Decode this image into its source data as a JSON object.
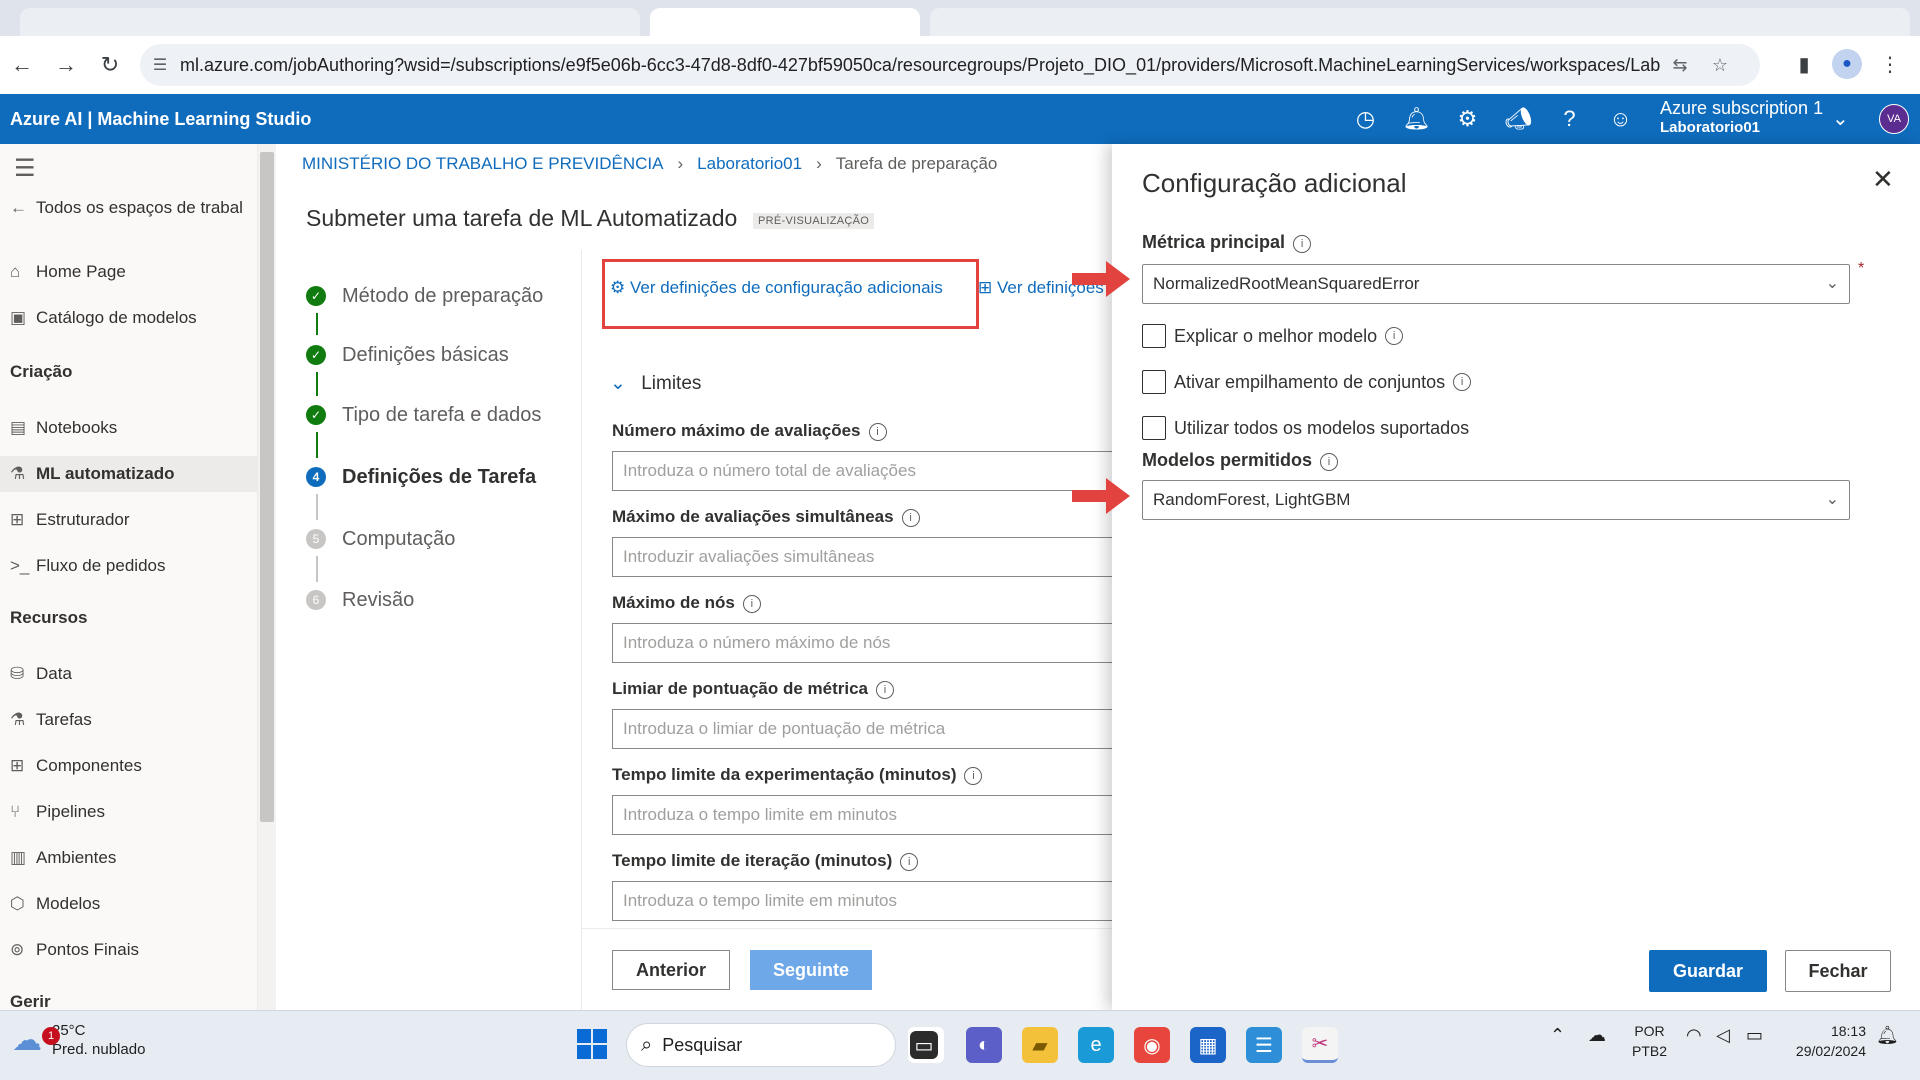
{
  "browser": {
    "url": "ml.azure.com/jobAuthoring?wsid=/subscriptions/e9f5e06b-6cc3-47d8-8df0-427bf59050ca/resourcegroups/Projeto_DIO_01/providers/Microsoft.MachineLearningServices/workspaces/Laborat...",
    "icons": {
      "back": "arrow-left",
      "forward": "arrow-right",
      "reload": "reload",
      "site_info": "tune",
      "translate": "translate",
      "bookmark": "star",
      "sidepanel": "sidepanel",
      "profile": "person",
      "menu": "kebab"
    }
  },
  "azure_header": {
    "brand": "Azure AI | Machine Learning Studio",
    "subscription": "Azure subscription 1",
    "workspace": "Laboratorio01",
    "avatar": "VA",
    "icons": [
      "history",
      "bell",
      "gear",
      "megaphone",
      "help",
      "smiley"
    ]
  },
  "sidebar": {
    "all_workspaces": "Todos os espaços de trabal",
    "items_top": [
      {
        "label": "Home Page",
        "icon": "home"
      },
      {
        "label": "Catálogo de modelos",
        "icon": "catalog"
      }
    ],
    "section_creation": "Criação",
    "items_creation": [
      {
        "label": "Notebooks",
        "icon": "notebook"
      },
      {
        "label": "ML automatizado",
        "icon": "automl",
        "active": true
      },
      {
        "label": "Estruturador",
        "icon": "designer"
      },
      {
        "label": "Fluxo de pedidos",
        "icon": "prompt-flow"
      }
    ],
    "section_resources": "Recursos",
    "items_resources": [
      {
        "label": "Data",
        "icon": "data"
      },
      {
        "label": "Tarefas",
        "icon": "flask"
      },
      {
        "label": "Componentes",
        "icon": "components"
      },
      {
        "label": "Pipelines",
        "icon": "pipelines"
      },
      {
        "label": "Ambientes",
        "icon": "environments"
      },
      {
        "label": "Modelos",
        "icon": "cube"
      },
      {
        "label": "Pontos Finais",
        "icon": "endpoints"
      }
    ],
    "section_manage": "Gerir"
  },
  "breadcrumb": [
    "MINISTÉRIO DO TRABALHO E PREVIDÊNCIA",
    "Laboratorio01",
    "Tarefa de preparação"
  ],
  "page": {
    "title": "Submeter uma tarefa de ML Automatizado",
    "badge": "PRÉ-VISUALIZAÇÃO"
  },
  "wizard_steps": [
    {
      "label": "Método de preparação",
      "state": "done",
      "mark": "✓"
    },
    {
      "label": "Definições básicas",
      "state": "done",
      "mark": "✓"
    },
    {
      "label": "Tipo de tarefa e dados",
      "state": "done",
      "mark": "✓"
    },
    {
      "label": "Definições de Tarefa",
      "state": "current",
      "mark": "4"
    },
    {
      "label": "Computação",
      "state": "pending",
      "mark": "5"
    },
    {
      "label": "Revisão",
      "state": "pending",
      "mark": "6"
    }
  ],
  "task_settings": {
    "view_additional_config": "Ver definições de configuração adicionais",
    "view_featurization": "Ver definições",
    "limits_header": "Limites",
    "fields": [
      {
        "label": "Número máximo de avaliações",
        "placeholder": "Introduza o número total de avaliações"
      },
      {
        "label": "Máximo de avaliações simultâneas",
        "placeholder": "Introduzir avaliações simultâneas"
      },
      {
        "label": "Máximo de nós",
        "placeholder": "Introduza o número máximo de nós"
      },
      {
        "label": "Limiar de pontuação de métrica",
        "placeholder": "Introduza o limiar de pontuação de métrica"
      },
      {
        "label": "Tempo limite da experimentação (minutos)",
        "placeholder": "Introduza o tempo limite em minutos"
      },
      {
        "label": "Tempo limite de iteração (minutos)",
        "placeholder": "Introduza o tempo limite em minutos"
      }
    ],
    "btn_previous": "Anterior",
    "btn_next": "Seguinte"
  },
  "panel": {
    "title": "Configuração adicional",
    "primary_metric_label": "Métrica principal",
    "primary_metric_value": "NormalizedRootMeanSquaredError",
    "required_mark": "*",
    "checkboxes": [
      {
        "label": "Explicar o melhor modelo",
        "checked": false,
        "info": true
      },
      {
        "label": "Ativar empilhamento de conjuntos",
        "checked": false,
        "info": true
      },
      {
        "label": "Utilizar todos os modelos suportados",
        "checked": false,
        "info": false
      }
    ],
    "allowed_models_label": "Modelos permitidos",
    "allowed_models_value": "RandomForest, LightGBM",
    "btn_save": "Guardar",
    "btn_close": "Fechar",
    "accent": "#0f6cbd"
  },
  "annotations": {
    "color": "#e3433f"
  },
  "taskbar": {
    "weather_temp": "25°C",
    "weather_desc": "Pred. nublado",
    "weather_badge": "1",
    "search": "Pesquisar",
    "lang_1": "POR",
    "lang_2": "PTB2",
    "time": "18:13",
    "date": "29/02/2024"
  }
}
